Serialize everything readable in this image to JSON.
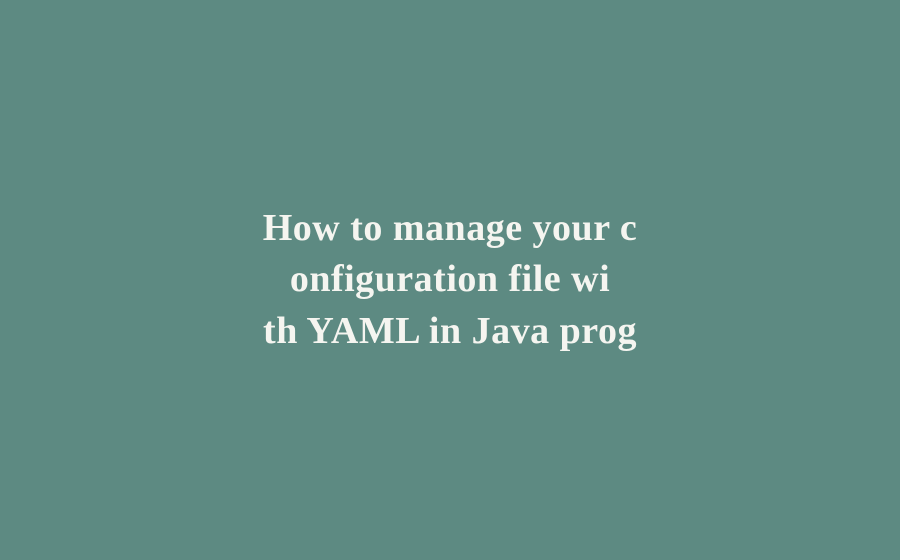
{
  "background_color": "#5d8a82",
  "text_color": "#f5f5f0",
  "heading": {
    "line1": "How to manage your c",
    "line2": "onfiguration file wi",
    "line3": "th YAML in Java prog"
  }
}
